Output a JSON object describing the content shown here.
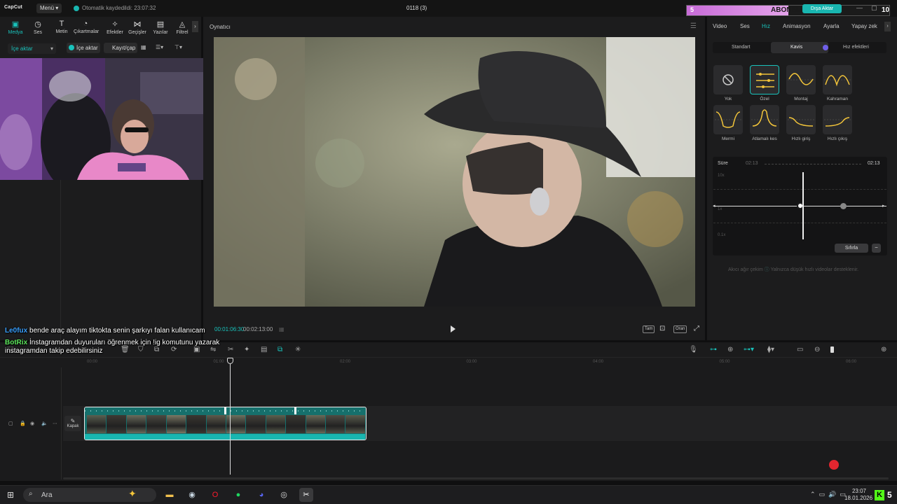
{
  "titlebar": {
    "logo": "CapCut",
    "menu_label": "Menü",
    "autosave_text": "Otomatik kaydedildi: 23:07:32",
    "project_title": "0118 (3)",
    "export_label": "Dışa Aktar",
    "subscription": {
      "count": "5",
      "label": "ABONELİK",
      "goal": "10",
      "progress": 0.5
    }
  },
  "toolbar_tabs": [
    {
      "label": "Medya",
      "icon": "media-icon",
      "active": true
    },
    {
      "label": "Ses",
      "icon": "audio-icon"
    },
    {
      "label": "Metin",
      "icon": "text-icon"
    },
    {
      "label": "Çıkartmalar",
      "icon": "sticker-icon"
    },
    {
      "label": "Efektler",
      "icon": "effects-icon"
    },
    {
      "label": "Geçişler",
      "icon": "transitions-icon"
    },
    {
      "label": "Yazılar",
      "icon": "captions-icon"
    },
    {
      "label": "Filtrel",
      "icon": "filters-icon"
    }
  ],
  "media": {
    "import_dropdown": "İçe aktar",
    "import_button": "İçe aktar",
    "record_button": "Kayıt/çap"
  },
  "player": {
    "title": "Oynatıcı",
    "time_current": "00:01:06:30",
    "time_total": "00:02:13:00",
    "buttons": {
      "full": "Tam",
      "ratio": "Oran"
    }
  },
  "right_tabs": [
    {
      "label": "Video"
    },
    {
      "label": "Ses"
    },
    {
      "label": "Hız",
      "active": true
    },
    {
      "label": "Animasyon"
    },
    {
      "label": "Ayarla"
    },
    {
      "label": "Yapay zek"
    }
  ],
  "speed": {
    "segments": [
      "Standart",
      "Kavis",
      "Hız efektleri"
    ],
    "presets": [
      {
        "label": "Yok"
      },
      {
        "label": "Özel",
        "selected": true
      },
      {
        "label": "Montaj"
      },
      {
        "label": "Kahraman"
      },
      {
        "label": "Mermi"
      },
      {
        "label": "Atlamalı kes"
      },
      {
        "label": "Hızlı giriş"
      },
      {
        "label": "Hızlı çıkış"
      }
    ],
    "graph": {
      "duration_label": "Süre",
      "duration_start": "02:13",
      "duration_end": "02:13",
      "y_labels": [
        "10x",
        "1x",
        "0.1x"
      ]
    },
    "reset_label": "Sıfırla",
    "smooth_label": "Akıcı ağır çekim",
    "smooth_hint": "Yalnızca düşük hızlı videolar desteklenir."
  },
  "chat": [
    {
      "user": "Le0fux",
      "user_color": "#3aa0ff",
      "message": "bende araç alayım tiktokta senin şarkıyı falan kullanıcam"
    },
    {
      "user": "BotRix",
      "user_color": "#5ce65c",
      "message": "İnstagramdan duyuruları öğrenmek için !ig komutunu yazarak",
      "message2": "instagramdan takip edebilirsiniz"
    }
  ],
  "timeline": {
    "ruler": [
      "00:00",
      "01:00",
      "02:00",
      "03:00",
      "04:00",
      "05:00",
      "06:00"
    ],
    "cover_label": "Kapak"
  },
  "taskbar": {
    "search_placeholder": "Ara",
    "time": "23:07",
    "date": "18.01.2026",
    "kick_count": "5"
  }
}
